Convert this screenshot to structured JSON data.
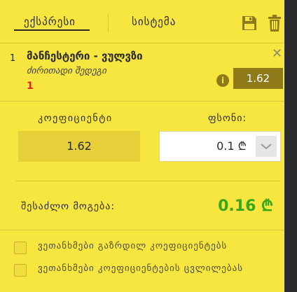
{
  "tabs": {
    "express": "ექსპრესი",
    "system": "სისტემა"
  },
  "toolbar": {
    "save_icon": "save-icon",
    "trash_icon": "trash-icon"
  },
  "bet": {
    "index": "1",
    "match": "მანჩესტერი - ვულვზი",
    "market": "ძირითადი შედეგი",
    "pick": "1",
    "odd": "1.62",
    "close_symbol": "✕",
    "info_symbol": "i"
  },
  "odds": {
    "label": "კოეფიციენტი",
    "value": "1.62"
  },
  "stake": {
    "label": "ფსონი:",
    "value": "0.1 ₾"
  },
  "potential_win": {
    "label": "შესაძლო მოგება:",
    "value": "0.16 ₾"
  },
  "options": [
    {
      "label": "ვეთანხმები გაზრდილ კოეფიციენტებს"
    },
    {
      "label": "ვეთანხმები კოეფიციენტების ცვლილებას"
    }
  ],
  "colors": {
    "panel_bg": "#f7e640",
    "badge_bg": "#8e7a18",
    "win_green": "#3aa61c",
    "pick_red": "#d42a1a"
  }
}
